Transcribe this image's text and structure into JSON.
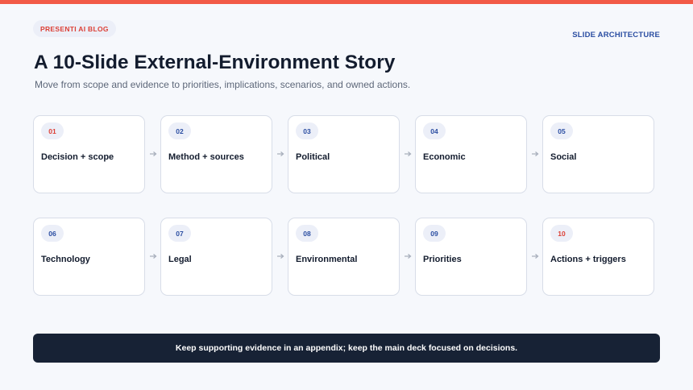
{
  "header": {
    "badge": "PRESENTI AI BLOG",
    "section_label": "SLIDE ARCHITECTURE",
    "title": "A 10-Slide External-Environment Story",
    "subtitle": "Move from scope and evidence to priorities, implications, scenarios, and owned actions."
  },
  "slides": [
    {
      "number": "01",
      "label": "Decision + scope",
      "accent": "red"
    },
    {
      "number": "02",
      "label": "Method + sources",
      "accent": "blue"
    },
    {
      "number": "03",
      "label": "Political",
      "accent": "blue"
    },
    {
      "number": "04",
      "label": "Economic",
      "accent": "blue"
    },
    {
      "number": "05",
      "label": "Social",
      "accent": "blue"
    },
    {
      "number": "06",
      "label": "Technology",
      "accent": "blue"
    },
    {
      "number": "07",
      "label": "Legal",
      "accent": "blue"
    },
    {
      "number": "08",
      "label": "Environmental",
      "accent": "blue"
    },
    {
      "number": "09",
      "label": "Priorities",
      "accent": "blue"
    },
    {
      "number": "10",
      "label": "Actions + triggers",
      "accent": "red"
    }
  ],
  "footer": {
    "text": "Keep supporting evidence in an appendix; keep the main deck focused on decisions."
  },
  "colors": {
    "accent_red": "#f25a47",
    "accent_blue": "#2b4ea2",
    "footer_bg": "#172235"
  }
}
